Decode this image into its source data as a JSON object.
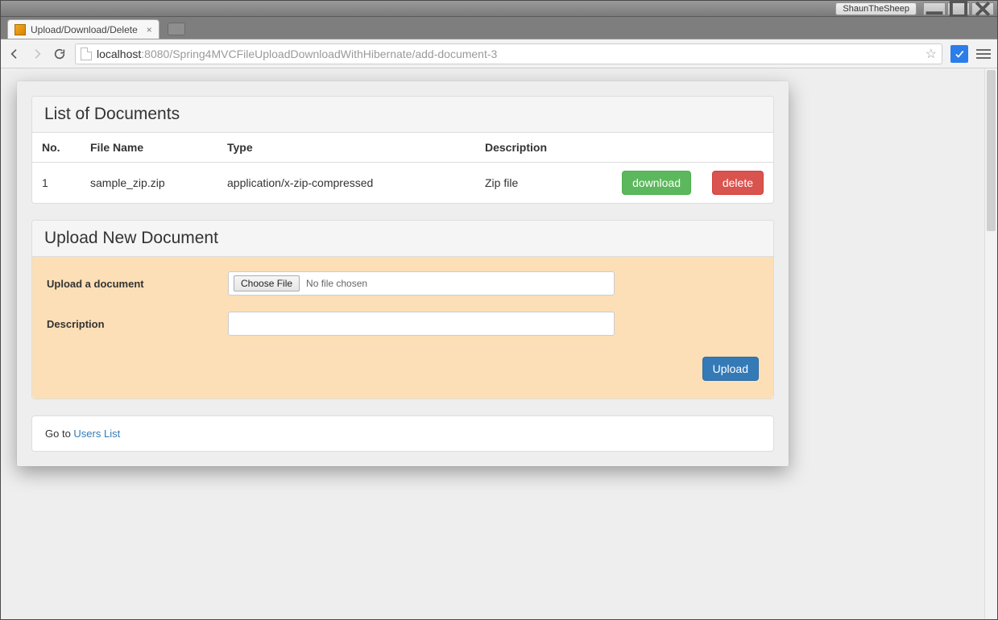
{
  "window": {
    "app_name": "ShaunTheSheep"
  },
  "tab": {
    "title": "Upload/Download/Delete"
  },
  "address": {
    "host": "localhost",
    "port": ":8080",
    "path": "/Spring4MVCFileUploadDownloadWithHibernate/add-document-3"
  },
  "list_panel": {
    "heading": "List of Documents",
    "columns": {
      "no": "No.",
      "file_name": "File Name",
      "type": "Type",
      "description": "Description"
    },
    "rows": [
      {
        "no": "1",
        "file_name": "sample_zip.zip",
        "type": "application/x-zip-compressed",
        "description": "Zip file",
        "download_label": "download",
        "delete_label": "delete"
      }
    ]
  },
  "upload_panel": {
    "heading": "Upload New Document",
    "file_label": "Upload a document",
    "choose_btn": "Choose File",
    "file_status": "No file chosen",
    "desc_label": "Description",
    "desc_value": "",
    "submit_label": "Upload"
  },
  "footer": {
    "goto_text": "Go to ",
    "link_text": "Users List"
  }
}
